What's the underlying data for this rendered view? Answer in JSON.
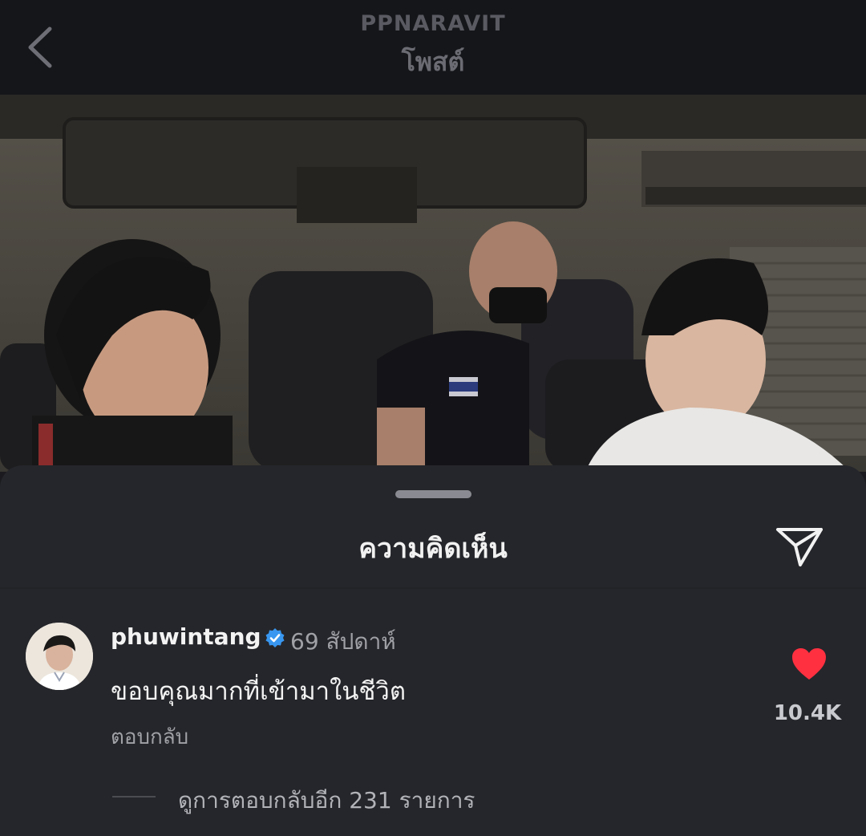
{
  "header": {
    "username": "PPNARAVIT",
    "title": "โพสต์"
  },
  "sheet": {
    "title": "ความคิดเห็น"
  },
  "comment": {
    "username": "phuwintang",
    "time": "69 สัปดาห์",
    "text": "ขอบคุณมากที่เข้ามาในชีวิต",
    "reply_label": "ตอบกลับ",
    "like_count": "10.4K",
    "view_replies": "ดูการตอบกลับอีก 231 รายการ",
    "verified": true
  },
  "icons": {
    "back": "chevron-left-icon",
    "share": "send-icon",
    "verified": "verified-badge-icon",
    "like": "heart-icon"
  },
  "colors": {
    "like": "#ff3040",
    "verified": "#3897f0"
  }
}
